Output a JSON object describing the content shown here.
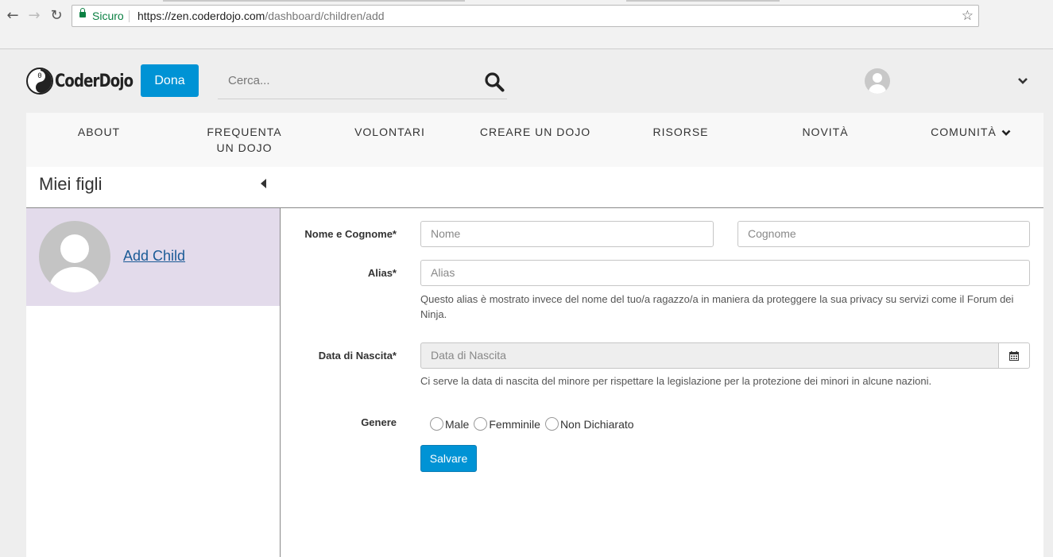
{
  "browser": {
    "secure_label": "Sicuro",
    "url_scheme_host": "https://zen.coderdojo.com",
    "url_path": "/dashboard/children/add"
  },
  "header": {
    "logo_text": "CoderDojo",
    "donate_label": "Dona",
    "search_placeholder": "Cerca..."
  },
  "nav": {
    "items": [
      "ABOUT",
      "FREQUENTA UN DOJO",
      "VOLONTARI",
      "CREARE UN DOJO",
      "RISORSE",
      "NOVITÀ",
      "COMUNITÀ"
    ]
  },
  "sidebar": {
    "title": "Miei figli",
    "add_child_label": "Add Child"
  },
  "form": {
    "name_label": "Nome e Cognome*",
    "first_name_placeholder": "Nome",
    "last_name_placeholder": "Cognome",
    "alias_label": "Alias*",
    "alias_placeholder": "Alias",
    "alias_help": "Questo alias è mostrato invece del nome del tuo/a ragazzo/a in maniera da proteggere la sua privacy su servizi come il Forum dei Ninja.",
    "dob_label": "Data di Nascita*",
    "dob_placeholder": "Data di Nascita",
    "dob_help": "Ci serve la data di nascita del minore per rispettare la legislazione per la protezione dei minori in alcune nazioni.",
    "gender_label": "Genere",
    "gender_options": [
      "Male",
      "Femminile",
      "Non Dichiarato"
    ],
    "save_label": "Salvare"
  },
  "colors": {
    "accent": "#0093d5",
    "sidebar_selected": "#e3dbeb",
    "link": "#1a5a96"
  },
  "icons": [
    "back-icon",
    "forward-icon",
    "reload-icon",
    "lock-icon",
    "star-icon",
    "search-icon",
    "chevron-down-icon",
    "caret-left-icon",
    "calendar-icon"
  ]
}
